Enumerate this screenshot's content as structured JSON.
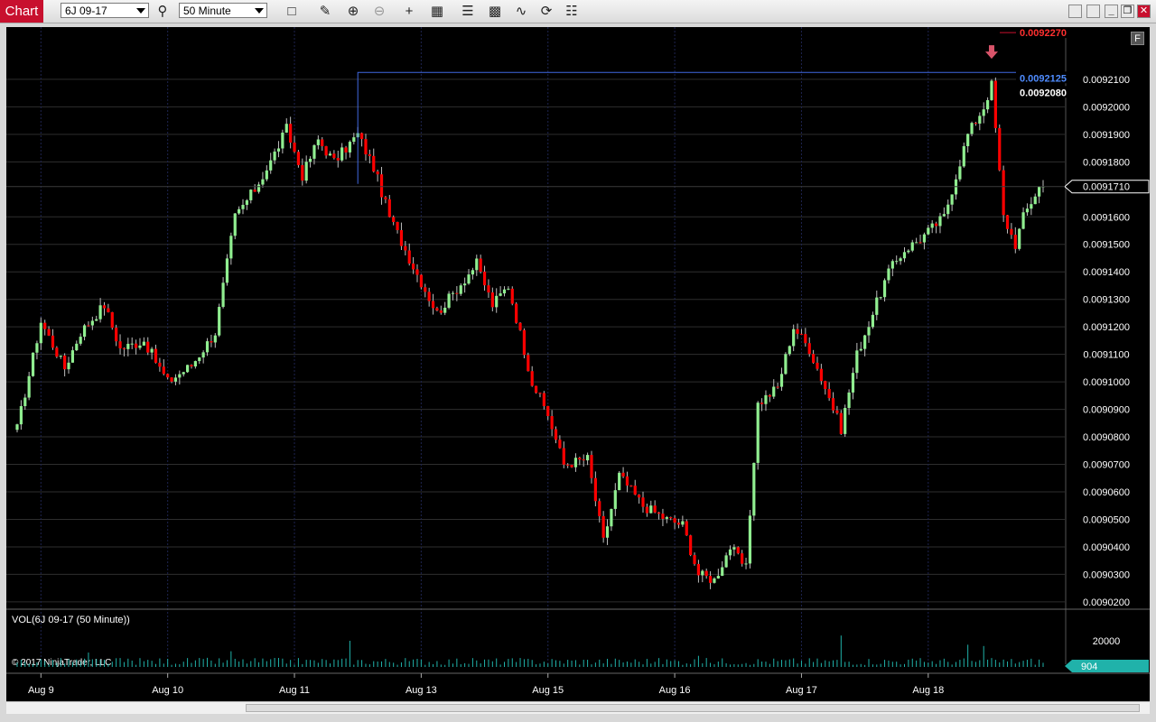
{
  "window": {
    "tab_label": "Chart",
    "instrument": "6J 09-17",
    "timeframe": "50 Minute",
    "controls": [
      "minimize",
      "restore",
      "close"
    ]
  },
  "toolbar_icons": [
    "box-icon",
    "pencil-icon",
    "zoom-in-icon",
    "zoom-out-icon",
    "crosshair-icon",
    "data-box-icon",
    "bars-icon",
    "strategy-icon",
    "indicator-icon",
    "refresh-icon",
    "properties-icon"
  ],
  "flag_button": "F",
  "volume_panel": {
    "title": "VOL(6J 09-17 (50 Minute))",
    "axis_label": "20000",
    "current_value": "904"
  },
  "copyright": "© 2017 NinjaTrader, LLC",
  "price_axis": {
    "labels": [
      "0.0092100",
      "0.0092000",
      "0.0091900",
      "0.0091800",
      "0.0091600",
      "0.0091500",
      "0.0091400",
      "0.0091300",
      "0.0091200",
      "0.0091100",
      "0.0091000",
      "0.0090900",
      "0.0090800",
      "0.0090700",
      "0.0090600",
      "0.0090500",
      "0.0090400",
      "0.0090300",
      "0.0090200"
    ],
    "current_price": "0.0091710",
    "marker_high": "0.0092270",
    "marker_line": "0.0092125",
    "marker_bar_high": "0.0092080"
  },
  "date_axis": [
    "Aug 9",
    "Aug 10",
    "Aug 11",
    "Aug 13",
    "Aug 15",
    "Aug 16",
    "Aug 17",
    "Aug 18"
  ],
  "colors": {
    "up": "#90ee90",
    "down": "#ff0000",
    "background": "#000000",
    "volume": "#20b2aa",
    "marker_line": "#4169e1",
    "arrow": "#d9546a"
  },
  "chart_data": {
    "type": "candlestick",
    "y_unit": "price",
    "ylim": [
      0.009018,
      0.009229
    ],
    "anchor_points": [
      [
        0,
        0.009083
      ],
      [
        6,
        0.009122
      ],
      [
        12,
        0.009105
      ],
      [
        16,
        0.009118
      ],
      [
        22,
        0.009128
      ],
      [
        26,
        0.009112
      ],
      [
        32,
        0.009115
      ],
      [
        38,
        0.0091
      ],
      [
        44,
        0.009106
      ],
      [
        50,
        0.009118
      ],
      [
        55,
        0.00916
      ],
      [
        60,
        0.00917
      ],
      [
        64,
        0.00918
      ],
      [
        68,
        0.009192
      ],
      [
        72,
        0.009175
      ],
      [
        76,
        0.009188
      ],
      [
        80,
        0.00918
      ],
      [
        86,
        0.00919
      ],
      [
        90,
        0.009178
      ],
      [
        94,
        0.00916
      ],
      [
        100,
        0.009142
      ],
      [
        106,
        0.009125
      ],
      [
        110,
        0.009132
      ],
      [
        116,
        0.009143
      ],
      [
        120,
        0.009128
      ],
      [
        124,
        0.009135
      ],
      [
        130,
        0.0091
      ],
      [
        134,
        0.009088
      ],
      [
        138,
        0.00907
      ],
      [
        144,
        0.009072
      ],
      [
        148,
        0.009042
      ],
      [
        152,
        0.009066
      ],
      [
        158,
        0.009055
      ],
      [
        164,
        0.00905
      ],
      [
        168,
        0.009048
      ],
      [
        172,
        0.00903
      ],
      [
        176,
        0.009028
      ],
      [
        180,
        0.00904
      ],
      [
        184,
        0.009032
      ],
      [
        187,
        0.009092
      ],
      [
        192,
        0.009098
      ],
      [
        196,
        0.00912
      ],
      [
        200,
        0.009112
      ],
      [
        204,
        0.009098
      ],
      [
        208,
        0.009083
      ],
      [
        212,
        0.00911
      ],
      [
        216,
        0.009125
      ],
      [
        220,
        0.00914
      ],
      [
        224,
        0.009148
      ],
      [
        228,
        0.009152
      ],
      [
        234,
        0.00916
      ],
      [
        238,
        0.00918
      ],
      [
        240,
        0.00919
      ],
      [
        244,
        0.0092
      ],
      [
        246,
        0.009208
      ],
      [
        249,
        0.00916
      ],
      [
        252,
        0.00915
      ],
      [
        254,
        0.00916
      ],
      [
        258,
        0.009171
      ]
    ],
    "volume_max": 20000,
    "spikes": [
      [
        54,
        12000
      ],
      [
        84,
        20000
      ],
      [
        172,
        8500
      ],
      [
        208,
        24000
      ],
      [
        240,
        17000
      ],
      [
        244,
        16000
      ],
      [
        18,
        11000
      ]
    ]
  }
}
